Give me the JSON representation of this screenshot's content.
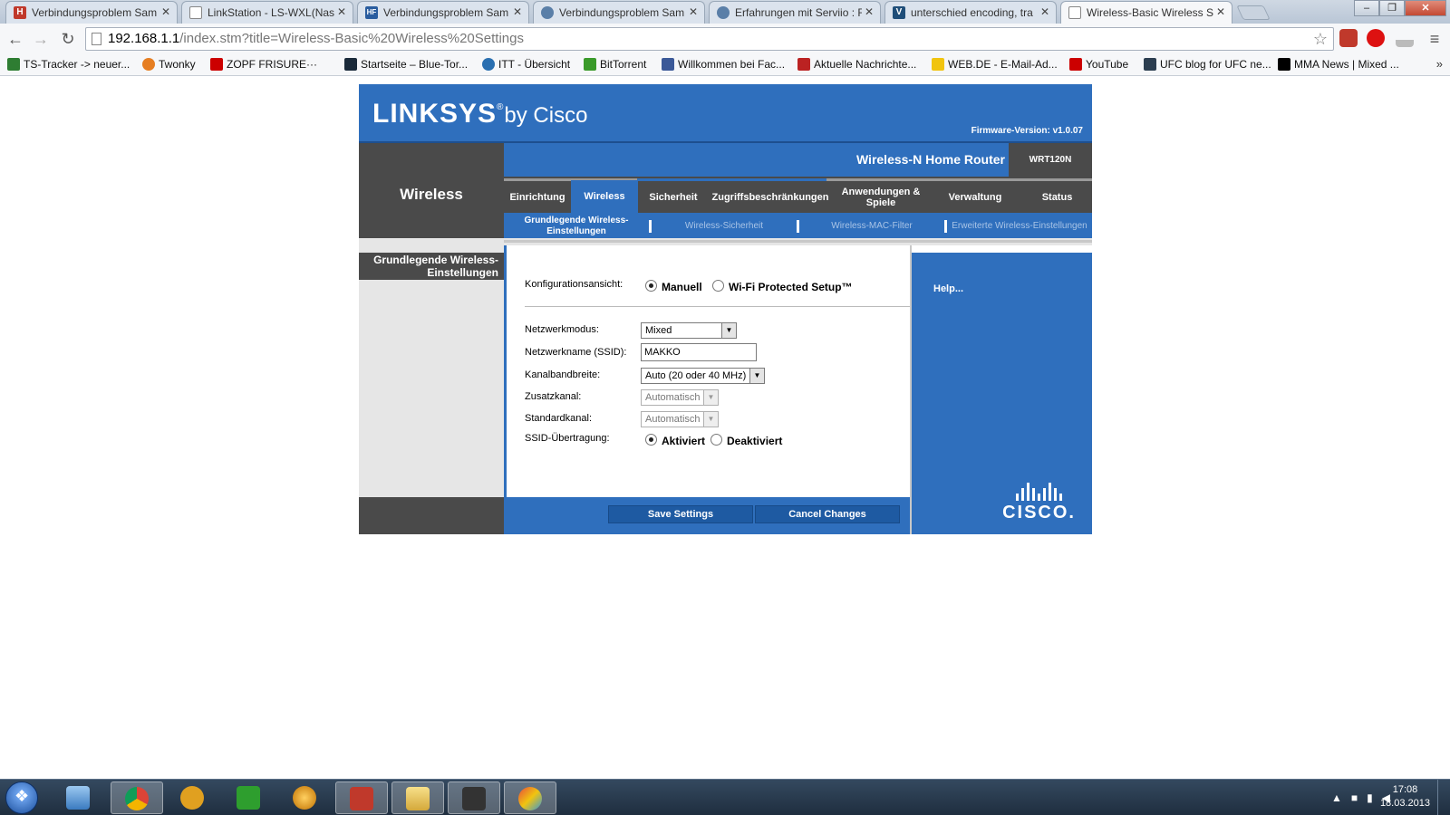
{
  "browser": {
    "tabs": [
      {
        "title": "Verbindungsproblem Sam",
        "favicon": "H"
      },
      {
        "title": "LinkStation - LS-WXL(Nas",
        "favicon": ""
      },
      {
        "title": "Verbindungsproblem Sam",
        "favicon": "HF"
      },
      {
        "title": "Verbindungsproblem Sam",
        "favicon": ""
      },
      {
        "title": "Erfahrungen mit Serviio : F",
        "favicon": ""
      },
      {
        "title": "unterschied encoding, tra",
        "favicon": "V"
      },
      {
        "title": "Wireless-Basic Wireless Se",
        "favicon": ""
      }
    ],
    "url_host": "192.168.1.1",
    "url_path": "/index.stm?title=Wireless-Basic%20Wireless%20Settings",
    "bookmarks": [
      "TS-Tracker -> neuer...",
      "Twonky",
      "ZOPF FRISURE···",
      "Startseite – Blue-Tor...",
      "ITT - Übersicht",
      "BitTorrent",
      "Willkommen bei Fac...",
      "Aktuelle Nachrichte...",
      "WEB.DE - E-Mail-Ad...",
      "YouTube",
      "UFC blog for UFC ne...",
      "MMA News | Mixed ..."
    ],
    "more": "»"
  },
  "router": {
    "brand": "LINKSYS",
    "brand_by": "by Cisco",
    "firmware": "Firmware-Version: v1.0.07",
    "section": "Wireless",
    "product_name": "Wireless-N Home Router",
    "model": "WRT120N",
    "tabs": [
      "Einrichtung",
      "Wireless",
      "Sicherheit",
      "Zugriffsbeschränkungen",
      "Anwendungen & Spiele",
      "Verwaltung",
      "Status"
    ],
    "subtabs": [
      "Grundlegende Wireless-Einstellungen",
      "Wireless-Sicherheit",
      "Wireless-MAC-Filter",
      "Erweiterte Wireless-Einstellungen"
    ],
    "left_heading": "Grundlegende Wireless-Einstellungen",
    "help": "Help...",
    "cisco": "CISCO.",
    "form": {
      "config_view_label": "Konfigurationsansicht:",
      "config_manual": "Manuell",
      "config_wps": "Wi-Fi Protected Setup™",
      "network_mode_label": "Netzwerkmodus:",
      "network_mode_value": "Mixed",
      "ssid_label": "Netzwerkname (SSID):",
      "ssid_value": "MAKKO",
      "bandwidth_label": "Kanalbandbreite:",
      "bandwidth_value": "Auto (20 oder 40 MHz)",
      "extra_channel_label": "Zusatzkanal:",
      "extra_channel_value": "Automatisch",
      "standard_channel_label": "Standardkanal:",
      "standard_channel_value": "Automatisch",
      "ssid_broadcast_label": "SSID-Übertragung:",
      "broadcast_on": "Aktiviert",
      "broadcast_off": "Deaktiviert"
    },
    "save": "Save Settings",
    "cancel": "Cancel Changes"
  },
  "taskbar": {
    "time": "17:08",
    "date": "18.03.2013"
  }
}
